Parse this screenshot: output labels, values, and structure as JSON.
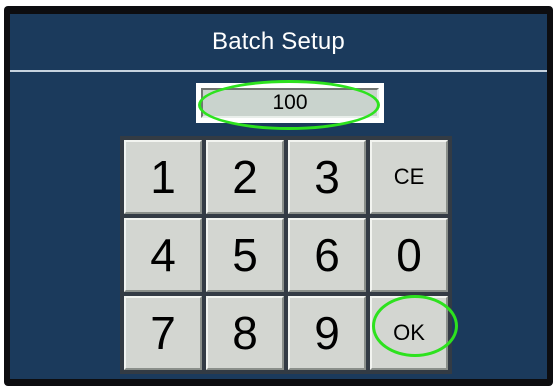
{
  "header": {
    "title": "Batch Setup"
  },
  "display": {
    "value": "100"
  },
  "keypad": {
    "rows": [
      [
        "1",
        "2",
        "3",
        "CE"
      ],
      [
        "4",
        "5",
        "6",
        "0"
      ],
      [
        "7",
        "8",
        "9",
        "OK"
      ]
    ]
  },
  "highlight_color": "#2de21e",
  "screen_color": "#1b3a5c"
}
